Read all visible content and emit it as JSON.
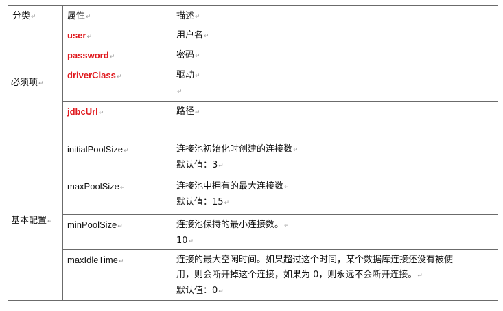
{
  "headers": {
    "category": "分类",
    "property": "属性",
    "description": "描述"
  },
  "groups": {
    "required": "必须项",
    "basic": "基本配置"
  },
  "rows": {
    "user": {
      "name": "user",
      "desc": "用户名"
    },
    "password": {
      "name": "password",
      "desc": "密码"
    },
    "driverClass": {
      "name": "driverClass",
      "desc": "驱动"
    },
    "jdbcUrl": {
      "name": "jdbcUrl",
      "desc": "路径"
    },
    "initialPoolSize": {
      "name": "initialPoolSize",
      "desc": "连接池初始化时创建的连接数",
      "default": "默认值：3"
    },
    "maxPoolSize": {
      "name": "maxPoolSize",
      "desc": "连接池中拥有的最大连接数",
      "default": "默认值：15"
    },
    "minPoolSize": {
      "name": "minPoolSize",
      "desc": "连接池保持的最小连接数。",
      "default": "10"
    },
    "maxIdleTime": {
      "name": "maxIdleTime",
      "desc_line1": "连接的最大空闲时间。如果超过这个时间，某个数据库连接还没有被使",
      "desc_line2": "用，则会断开掉这个连接，如果为 0，则永远不会断开连接。",
      "default": "默认值：0"
    }
  },
  "colors": {
    "required_property": "#e0191e",
    "border": "#6b6b6b",
    "paragraph_mark": "#9a9a9a"
  }
}
